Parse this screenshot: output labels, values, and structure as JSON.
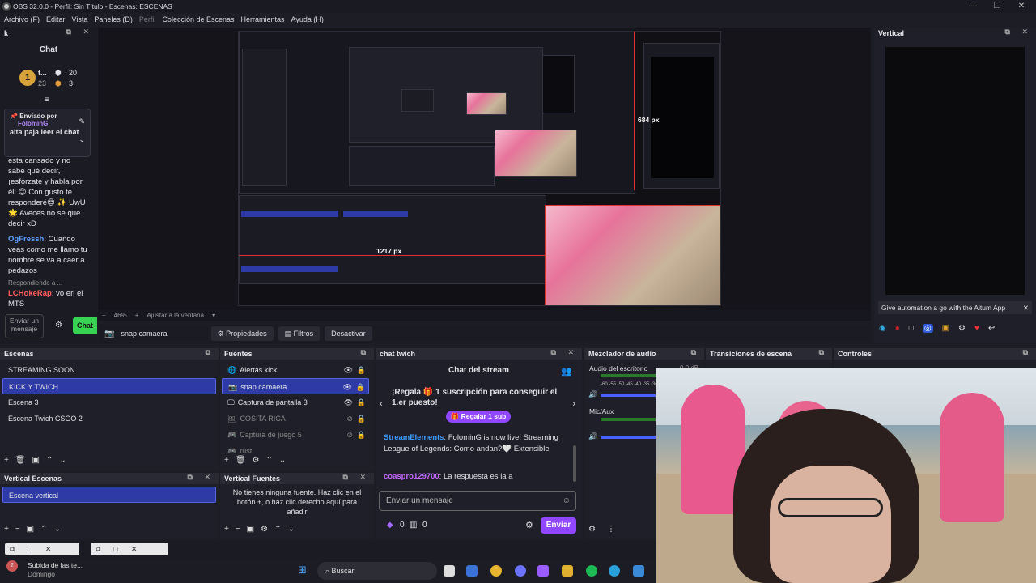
{
  "window": {
    "title": "OBS 32.0.0 - Perfil: Sin Título - Escenas: ESCENAS"
  },
  "menu": [
    "Archivo (F)",
    "Editar",
    "Vista",
    "Paneles (D)",
    "Perfil",
    "Colección de Escenas",
    "Herramientas",
    "Ayuda (H)"
  ],
  "left_chat": {
    "dock_title": "k",
    "title": "Chat",
    "stats": {
      "name": "t...",
      "a": "20",
      "b": "23",
      "c": "3"
    },
    "pinned_label": "Enviado por",
    "pinned_user": "FolominG",
    "pinned_text": "alta paja leer el chat",
    "messages": [
      {
        "text": "esta cansado y no sabe qué decir, ¡esforzate y habla por él! 😊 Con gusto te responderé😍 ✨ UwU 🌟 Aveces no se que decir xD"
      },
      {
        "user": "OgFressh",
        "text": ": Cuando veas como me llamo tu nombre se va a caer a pedazos"
      },
      {
        "reply": "Respondiendo a ..."
      },
      {
        "user": "LCHokeRap",
        "text": ": vo eri el MTS"
      }
    ],
    "input_placeholder": "Enviar un mensaje",
    "chat_button": "Chat"
  },
  "preview": {
    "size_label_v": "684 px",
    "size_label_h": "1217 px",
    "zoom": "46%",
    "fit": "Ajustar a la ventana"
  },
  "vertical_dock": {
    "title": "Vertical",
    "notice": "Give automation a go with the Aitum App"
  },
  "source_toolbar": {
    "source": "snap camaera",
    "properties": "Propiedades",
    "filters": "Filtros",
    "deactivate": "Desactivar"
  },
  "scenes": {
    "title": "Escenas",
    "items": [
      "STREAMING SOON",
      "KICK Y TWICH",
      "Escena 3",
      "Escena Twich CSGO 2"
    ],
    "active": 1
  },
  "sources": {
    "title": "Fuentes",
    "items": [
      {
        "name": "Alertas kick",
        "icon": "globe-icon"
      },
      {
        "name": "snap camaera",
        "icon": "camera-icon"
      },
      {
        "name": "Captura de pantalla 3",
        "icon": "monitor-icon"
      },
      {
        "name": "COSITA RICA",
        "icon": "image-icon"
      },
      {
        "name": "Captura de juego 5",
        "icon": "gamepad-icon"
      },
      {
        "name": "rust",
        "icon": "gamepad-icon"
      }
    ],
    "active": 1
  },
  "twitch_chat": {
    "dock_title": "chat twich",
    "title": "Chat del stream",
    "promo": "¡Regala 🎁 1 suscripción para conseguir el 1.er puesto!",
    "gift_button": "Regalar 1 sub",
    "messages": [
      {
        "user": "StreamElements",
        "text": ": FolominG is now live! Streaming League of Legends: Como andan?🤍 Extensible"
      },
      {
        "user": "coaspro129700",
        "text": ": La respuesta es la a"
      }
    ],
    "input_placeholder": "Enviar un mensaje",
    "points_a": "0",
    "points_b": "0",
    "send": "Enviar"
  },
  "audio": {
    "title": "Mezclador de audio",
    "channels": [
      {
        "name": "Audio del escritorio",
        "db": "0.0 dB"
      },
      {
        "name": "Mic/Aux"
      }
    ],
    "scale": "-60 -55 -50 -45 -40 -35 -30"
  },
  "transitions": {
    "title": "Transiciones de escena"
  },
  "controls": {
    "title": "Controles"
  },
  "vertical_scenes": {
    "title": "Vertical Escenas",
    "items": [
      "Escena vertical"
    ]
  },
  "vertical_sources": {
    "title": "Vertical Fuentes",
    "empty_text": "No tienes ninguna fuente. Haz clic en el botón +, o haz clic derecho aquí para añadir"
  },
  "taskbar": {
    "notif_title": "Subida de las te...",
    "notif_sub": "Domingo",
    "search": "Buscar"
  },
  "colors": {
    "accent": "#2e3aa6",
    "twitch": "#9147ff",
    "bg": "#1f1f29"
  }
}
